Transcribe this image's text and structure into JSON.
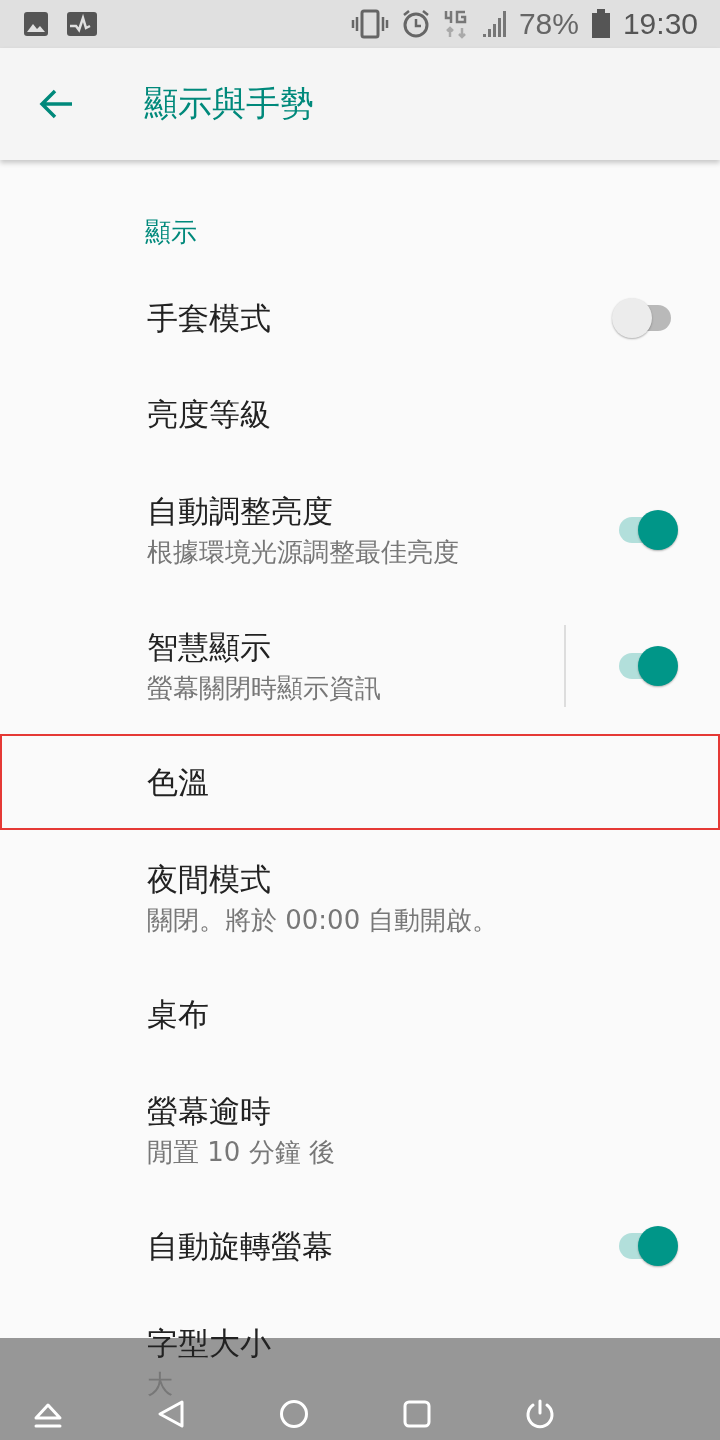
{
  "status_bar": {
    "battery": "78%",
    "time": "19:30"
  },
  "app_bar": {
    "title": "顯示與手勢"
  },
  "section": {
    "title": "顯示"
  },
  "items": [
    {
      "title": "手套模式",
      "kind": "switch",
      "on": false
    },
    {
      "title": "亮度等級",
      "kind": "plain"
    },
    {
      "title": "自動調整亮度",
      "subtitle": "根據環境光源調整最佳亮度",
      "kind": "switch",
      "on": true
    },
    {
      "title": "智慧顯示",
      "subtitle": "螢幕關閉時顯示資訊",
      "kind": "split-switch",
      "on": true
    },
    {
      "title": "色溫",
      "kind": "plain",
      "selected": true
    },
    {
      "title": "夜間模式",
      "subtitle": "關閉。將於 00:00 自動開啟。",
      "kind": "plain"
    },
    {
      "title": "桌布",
      "kind": "plain"
    },
    {
      "title": "螢幕逾時",
      "subtitle": "閒置 10 分鐘 後",
      "kind": "plain"
    },
    {
      "title": "自動旋轉螢幕",
      "kind": "switch",
      "on": true
    },
    {
      "title": "字型大小",
      "subtitle": "大",
      "kind": "plain"
    }
  ]
}
